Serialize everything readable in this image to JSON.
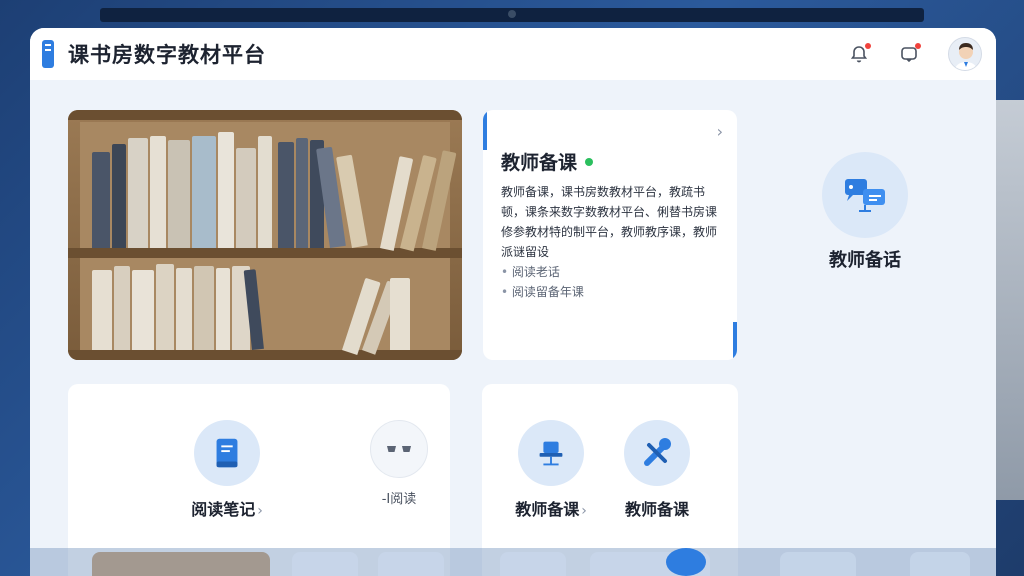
{
  "app": {
    "title": "课书房数字教材平台",
    "accent": "#2e7de0"
  },
  "header": {
    "icons": [
      "bell-icon",
      "message-icon",
      "avatar"
    ]
  },
  "prep_card": {
    "title": "教师备课",
    "status_color": "#2bbf5e",
    "description": "教师备课，课书房数教材平台，教疏书顿，课条来数字数教材平台、俐替书房课修参教材特的制平台，教师教序课，教师派谜留设",
    "list": [
      "阅读老话",
      "阅读留备年课"
    ]
  },
  "feature_right": {
    "label": "教师备话",
    "icon": "presentation-icon"
  },
  "card_b1": {
    "tiles": [
      {
        "label": "阅读笔记",
        "icon": "book-icon"
      },
      {
        "label": "-I阅读",
        "icon": "glasses-icon"
      }
    ]
  },
  "card_b2": {
    "tiles": [
      {
        "label": "教师备课",
        "icon": "projector-icon"
      },
      {
        "label": "教师备课",
        "icon": "tools-icon"
      }
    ]
  }
}
